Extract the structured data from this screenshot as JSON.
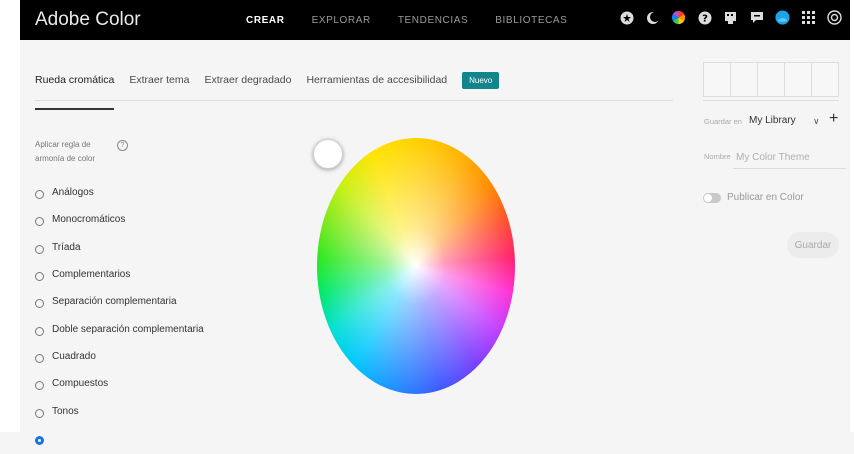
{
  "brand": "Adobe Color",
  "nav": [
    "CREAR",
    "EXPLORAR",
    "TENDENCIAS",
    "BIBLIOTECAS"
  ],
  "tabs": [
    "Rueda cromática",
    "Extraer tema",
    "Extraer degradado",
    "Herramientas de accesibilidad"
  ],
  "new_badge": "Nuevo",
  "harmony": {
    "title_line1": "Aplicar regla de",
    "title_line2": "armonía de color",
    "help": "?",
    "rules": [
      "Análogos",
      "Monocromáticos",
      "Tríada",
      "Complementarios",
      "Separación complementaria",
      "Doble separación complementaria",
      "Cuadrado",
      "Compuestos",
      "Tonos"
    ]
  },
  "side": {
    "save_in_label": "Guardar en",
    "library": "My Library",
    "add": "+",
    "name_label": "Nombre",
    "name_placeholder": "My Color Theme",
    "publish_label": "Publicar en Color",
    "save_button": "Guardar"
  },
  "colors": {
    "accent": "#12848c",
    "radio_selected": "#1473e6",
    "topbar": "#000000"
  },
  "icons": [
    "stock-icon",
    "moon-icon",
    "color-wheel-icon",
    "help-icon",
    "feed-icon",
    "chat-icon",
    "avatar-icon",
    "apps-grid-icon",
    "creative-cloud-icon"
  ]
}
